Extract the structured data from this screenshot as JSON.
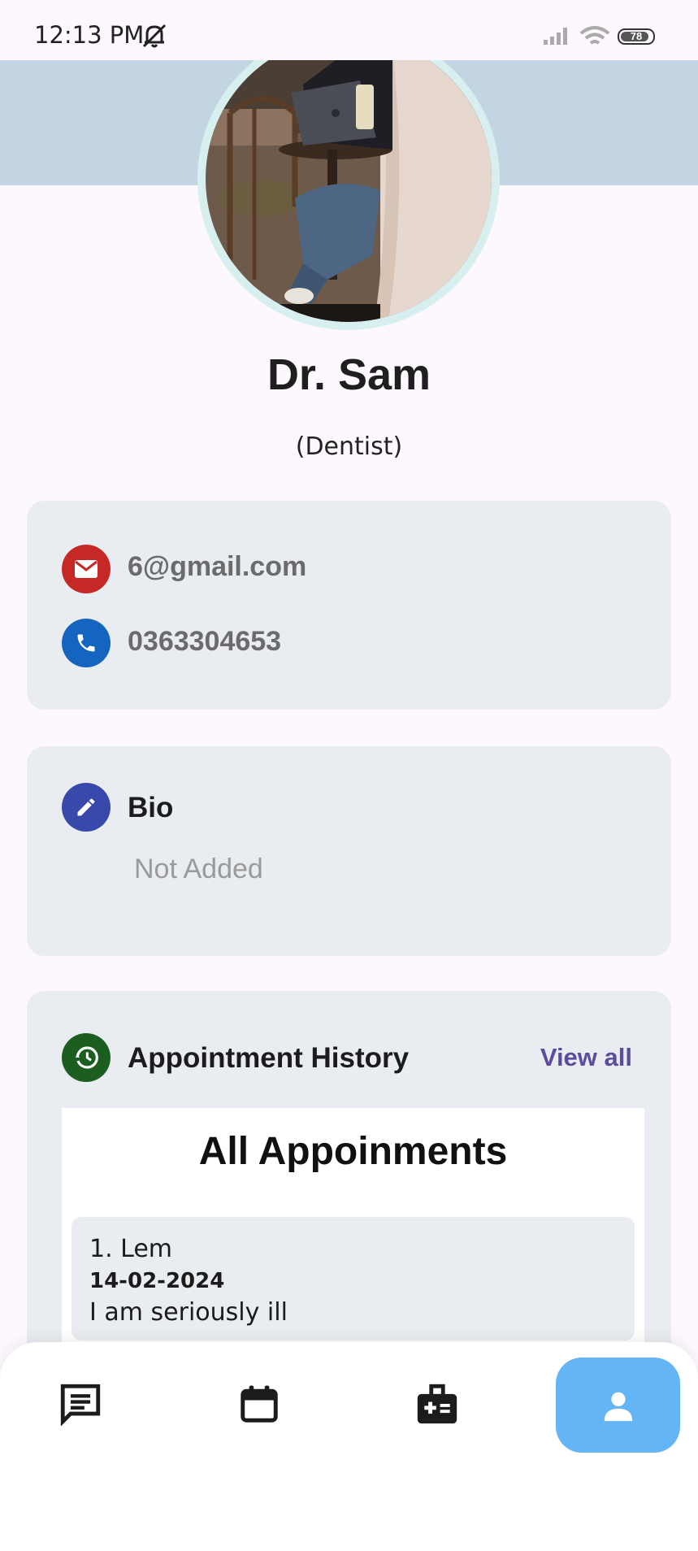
{
  "status_bar": {
    "time": "12:13 PM",
    "battery": "78",
    "icons": [
      "bell-off-icon",
      "signal-icon",
      "wifi-icon",
      "battery-icon"
    ]
  },
  "profile": {
    "name": "Dr. Sam",
    "specialty": "(Dentist)",
    "avatar": "profile-photo"
  },
  "contact": {
    "email": "6@gmail.com",
    "phone": "0363304653",
    "email_icon_color": "#c62828",
    "phone_icon_color": "#1565c0"
  },
  "bio": {
    "title": "Bio",
    "value": "Not Added",
    "icon_color": "#3949ab"
  },
  "appointment_history": {
    "title": "Appointment History",
    "view_all_label": "View all",
    "icon_color": "#1b5e20",
    "panel_title": "All Appoinments",
    "items": [
      {
        "name": "1. Lem",
        "date": "14-02-2024",
        "reason": "I am seriously ill"
      }
    ]
  },
  "bottom_nav": {
    "items": [
      "chat-icon",
      "calendar-icon",
      "medical-bag-icon",
      "profile-icon"
    ],
    "active": "profile-icon",
    "active_color": "#64b5f6"
  },
  "system_nav": [
    "menu-icon",
    "home-icon",
    "back-icon"
  ]
}
